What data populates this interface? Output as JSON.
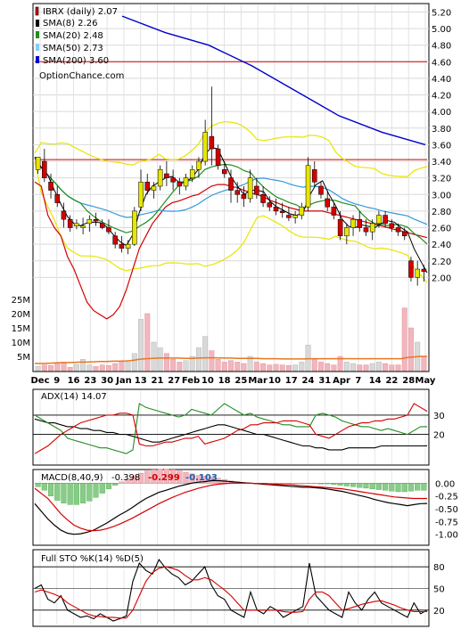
{
  "chart_data": [
    {
      "type": "candlestick",
      "title": "IBRX (daily) 2.07",
      "watermark": "OptionChance.com",
      "legend": [
        {
          "label": "SMA(8) 2.26",
          "color": "#000000"
        },
        {
          "label": "SMA(20) 2.48",
          "color": "#228b22"
        },
        {
          "label": "SMA(50) 2.73",
          "color": "#87cefa"
        },
        {
          "label": "SMA(200) 3.60",
          "color": "#0000cc"
        }
      ],
      "legend_placement": "top-left",
      "price_axis_ticks": [
        "5.20",
        "5.00",
        "4.80",
        "4.60",
        "4.40",
        "4.20",
        "4.00",
        "3.80",
        "3.60",
        "3.40",
        "3.20",
        "3.00",
        "2.80",
        "2.60",
        "2.40",
        "2.20",
        "2.00"
      ],
      "ylim": [
        1.8,
        5.28
      ],
      "volume_axis_ticks": [
        "25M",
        "20M",
        "15M",
        "10M",
        "5M"
      ],
      "volume_ylim": [
        0,
        30
      ],
      "x_labels": [
        "Dec",
        "9",
        "16",
        "23",
        "30",
        "Jan",
        "13",
        "21",
        "27",
        "Feb",
        "10",
        "18",
        "25",
        "Mar",
        "10",
        "17",
        "24",
        "31",
        "Apr",
        "7",
        "14",
        "22",
        "28",
        "May"
      ],
      "horizontal_lines": [
        4.6,
        3.42
      ],
      "sma200": [
        5.15,
        4.95,
        4.8,
        4.55,
        4.25,
        3.95,
        3.75,
        3.6
      ],
      "candles": [
        [
          3.3,
          3.45,
          3.25,
          3.45,
          3.15
        ],
        [
          3.4,
          3.55,
          3.15,
          3.2,
          3.1
        ],
        [
          3.15,
          3.25,
          2.95,
          3.05,
          2.75
        ],
        [
          3.0,
          3.1,
          2.85,
          2.9,
          2.6
        ],
        [
          2.8,
          2.9,
          2.6,
          2.7,
          2.5
        ],
        [
          2.7,
          2.75,
          2.55,
          2.6,
          2.25
        ],
        [
          2.62,
          2.7,
          2.58,
          2.65,
          2.1
        ],
        [
          2.6,
          2.72,
          2.52,
          2.62,
          1.9
        ],
        [
          2.65,
          2.75,
          2.55,
          2.7,
          1.7
        ],
        [
          2.7,
          2.78,
          2.62,
          2.68,
          1.6
        ],
        [
          2.65,
          2.7,
          2.58,
          2.6,
          1.55
        ],
        [
          2.6,
          2.7,
          2.52,
          2.55,
          1.5
        ],
        [
          2.5,
          2.55,
          2.35,
          2.4,
          1.55
        ],
        [
          2.4,
          2.5,
          2.3,
          2.35,
          1.65
        ],
        [
          2.35,
          2.45,
          2.28,
          2.4,
          1.85
        ],
        [
          2.4,
          2.85,
          2.38,
          2.8,
          2.1
        ],
        [
          2.85,
          3.3,
          2.8,
          3.15,
          2.35
        ],
        [
          3.15,
          3.25,
          3.0,
          3.05,
          2.5
        ],
        [
          3.05,
          3.15,
          2.95,
          3.1,
          2.65
        ],
        [
          3.1,
          3.35,
          3.05,
          3.3,
          2.75
        ],
        [
          3.25,
          3.4,
          3.1,
          3.2,
          2.85
        ],
        [
          3.2,
          3.3,
          3.05,
          3.15,
          2.9
        ],
        [
          3.15,
          3.2,
          3.0,
          3.1,
          2.92
        ],
        [
          3.1,
          3.25,
          3.05,
          3.2,
          2.95
        ],
        [
          3.2,
          3.35,
          3.15,
          3.3,
          2.98
        ],
        [
          3.3,
          3.45,
          3.2,
          3.4,
          3.0
        ],
        [
          3.4,
          3.9,
          3.35,
          3.75,
          3.05
        ],
        [
          3.7,
          4.3,
          3.35,
          3.55,
          3.1
        ],
        [
          3.55,
          3.6,
          3.3,
          3.35,
          3.12
        ],
        [
          3.3,
          3.4,
          3.2,
          3.25,
          3.12
        ],
        [
          3.2,
          3.3,
          2.9,
          3.05,
          3.1
        ],
        [
          3.05,
          3.15,
          2.9,
          3.0,
          3.08
        ],
        [
          3.0,
          3.1,
          2.85,
          2.95,
          3.05
        ],
        [
          2.95,
          3.3,
          2.9,
          3.2,
          3.02
        ],
        [
          3.1,
          3.2,
          2.95,
          3.0,
          3.0
        ],
        [
          3.0,
          3.1,
          2.85,
          2.9,
          2.97
        ],
        [
          2.9,
          2.98,
          2.8,
          2.85,
          2.93
        ],
        [
          2.85,
          2.95,
          2.75,
          2.8,
          2.9
        ],
        [
          2.8,
          2.9,
          2.72,
          2.78,
          2.87
        ],
        [
          2.75,
          2.85,
          2.68,
          2.72,
          2.84
        ],
        [
          2.72,
          2.8,
          2.65,
          2.75,
          2.82
        ],
        [
          2.75,
          2.9,
          2.7,
          2.85,
          2.8
        ],
        [
          2.85,
          3.45,
          2.8,
          3.35,
          2.8
        ],
        [
          3.3,
          3.4,
          3.1,
          3.15,
          2.8
        ],
        [
          3.1,
          3.15,
          2.95,
          3.0,
          2.8
        ],
        [
          2.95,
          3.05,
          2.8,
          2.85,
          2.78
        ],
        [
          2.85,
          2.9,
          2.7,
          2.75,
          2.76
        ],
        [
          2.7,
          2.8,
          2.45,
          2.5,
          2.74
        ],
        [
          2.5,
          2.65,
          2.4,
          2.6,
          2.72
        ],
        [
          2.6,
          2.75,
          2.5,
          2.7,
          2.7
        ],
        [
          2.7,
          2.8,
          2.55,
          2.6,
          2.68
        ],
        [
          2.6,
          2.7,
          2.5,
          2.55,
          2.66
        ],
        [
          2.55,
          2.7,
          2.45,
          2.65,
          2.64
        ],
        [
          2.65,
          2.8,
          2.6,
          2.75,
          2.62
        ],
        [
          2.75,
          2.8,
          2.6,
          2.65,
          2.6
        ],
        [
          2.65,
          2.7,
          2.55,
          2.6,
          2.58
        ],
        [
          2.6,
          2.65,
          2.5,
          2.55,
          2.56
        ],
        [
          2.55,
          2.6,
          2.45,
          2.5,
          2.54
        ],
        [
          2.2,
          2.25,
          1.95,
          2.0,
          2.52
        ],
        [
          2.0,
          2.2,
          1.9,
          2.1,
          2.5
        ],
        [
          2.1,
          2.15,
          1.95,
          2.07,
          2.48
        ]
      ],
      "volume": [
        1.5,
        2,
        1.8,
        2.5,
        3,
        1.2,
        2.2,
        4,
        2,
        1.5,
        2,
        1.8,
        2.5,
        3.2,
        3,
        6,
        18,
        20,
        10,
        8,
        6,
        4,
        3,
        3.5,
        5,
        8,
        12,
        7,
        4,
        3,
        3.5,
        3,
        2.5,
        5,
        3,
        2.5,
        2,
        2.2,
        2,
        1.8,
        2,
        3,
        9,
        4,
        3,
        2.5,
        2,
        5,
        3,
        2.5,
        2,
        2,
        2.5,
        3,
        2.5,
        2,
        2,
        22,
        15,
        10,
        5
      ],
      "volume_avg": [
        2.5,
        2.5,
        2.6,
        2.7,
        2.8,
        2.8,
        2.9,
        3,
        3,
        3.1,
        3.2,
        3.2,
        3.3,
        3.3,
        3.4,
        3.6,
        4,
        4.2,
        4.3,
        4.4,
        4.4,
        4.4,
        4.4,
        4.3,
        4.3,
        4.4,
        4.5,
        4.5,
        4.5,
        4.4,
        4.4,
        4.3,
        4.3,
        4.3,
        4.3,
        4.2,
        4.2,
        4.2,
        4.1,
        4.1,
        4.1,
        4.1,
        4.2,
        4.2,
        4.2,
        4.2,
        4.2,
        4.2,
        4.2,
        4.2,
        4.2,
        4.2,
        4.2,
        4.2,
        4.2,
        4.2,
        4.2,
        4.6,
        4.8,
        5,
        5
      ]
    },
    {
      "type": "line",
      "title": "ADX(14) 14.07",
      "ylim": [
        5,
        42
      ],
      "reference_lines": [
        20,
        30
      ],
      "series": [
        {
          "color": "#000000",
          "values": [
            28,
            27,
            26,
            26,
            25,
            24,
            24,
            23,
            23,
            22,
            22,
            21,
            21,
            20,
            20,
            19,
            18,
            17,
            16,
            16,
            17,
            18,
            19,
            20,
            21,
            22,
            23,
            24,
            25,
            25,
            24,
            23,
            22,
            21,
            20,
            20,
            19,
            18,
            17,
            16,
            15,
            14,
            14,
            13,
            13,
            12,
            12,
            12,
            13,
            13,
            13,
            13,
            13,
            14,
            14,
            14,
            14,
            14,
            14,
            14,
            14.07
          ]
        },
        {
          "color": "#228b22",
          "values": [
            30,
            28,
            26,
            24,
            22,
            18,
            17,
            16,
            15,
            14,
            13,
            13,
            12,
            11,
            10,
            12,
            36,
            34,
            33,
            32,
            31,
            30,
            29,
            30,
            33,
            32,
            31,
            30,
            33,
            36,
            34,
            32,
            30,
            31,
            29,
            28,
            27,
            26,
            25,
            25,
            24,
            24,
            24,
            30,
            31,
            30,
            29,
            27,
            26,
            25,
            24,
            24,
            23,
            22,
            23,
            22,
            21,
            20,
            22,
            24,
            24
          ]
        },
        {
          "color": "#d40000",
          "values": [
            10,
            12,
            14,
            17,
            20,
            22,
            24,
            26,
            27,
            28,
            29,
            30,
            30,
            31,
            31,
            30,
            15,
            14,
            14,
            15,
            16,
            16,
            17,
            18,
            18,
            19,
            15,
            16,
            17,
            18,
            20,
            22,
            23,
            25,
            25,
            26,
            26,
            26,
            27,
            27,
            27,
            26,
            25,
            20,
            19,
            18,
            20,
            22,
            24,
            25,
            26,
            26,
            27,
            27,
            28,
            28,
            29,
            30,
            36,
            34,
            32
          ]
        }
      ]
    },
    {
      "type": "line",
      "title": "MACD(8,40,9)",
      "values": [
        "-0.398",
        "-0.299",
        "-0.103"
      ],
      "ylim": [
        -1.18,
        0.18
      ],
      "y_ticks": [
        "0.00",
        "-0.25",
        "-0.50",
        "-0.75",
        "-1.00"
      ],
      "series": [
        {
          "color": "#000000",
          "values": [
            -0.4,
            -0.55,
            -0.7,
            -0.82,
            -0.92,
            -0.98,
            -1.0,
            -0.99,
            -0.96,
            -0.92,
            -0.85,
            -0.78,
            -0.7,
            -0.62,
            -0.55,
            -0.47,
            -0.38,
            -0.3,
            -0.24,
            -0.18,
            -0.14,
            -0.1,
            -0.06,
            -0.03,
            0.0,
            0.02,
            0.03,
            0.05,
            0.05,
            0.04,
            0.03,
            0.02,
            0.01,
            0.0,
            -0.01,
            -0.02,
            -0.03,
            -0.04,
            -0.05,
            -0.06,
            -0.07,
            -0.08,
            -0.08,
            -0.09,
            -0.1,
            -0.12,
            -0.14,
            -0.16,
            -0.19,
            -0.22,
            -0.25,
            -0.28,
            -0.32,
            -0.35,
            -0.38,
            -0.4,
            -0.42,
            -0.44,
            -0.42,
            -0.4,
            -0.398
          ]
        },
        {
          "color": "#d40000",
          "values": [
            -0.1,
            -0.2,
            -0.3,
            -0.45,
            -0.6,
            -0.72,
            -0.82,
            -0.88,
            -0.92,
            -0.93,
            -0.92,
            -0.89,
            -0.85,
            -0.8,
            -0.74,
            -0.68,
            -0.61,
            -0.54,
            -0.47,
            -0.4,
            -0.34,
            -0.28,
            -0.23,
            -0.18,
            -0.14,
            -0.1,
            -0.07,
            -0.04,
            -0.02,
            -0.01,
            0.0,
            0.0,
            0.0,
            0.0,
            -0.01,
            -0.01,
            -0.02,
            -0.02,
            -0.03,
            -0.03,
            -0.04,
            -0.05,
            -0.06,
            -0.07,
            -0.08,
            -0.09,
            -0.1,
            -0.11,
            -0.13,
            -0.15,
            -0.17,
            -0.19,
            -0.21,
            -0.23,
            -0.25,
            -0.27,
            -0.28,
            -0.29,
            -0.3,
            -0.3,
            -0.299
          ]
        }
      ],
      "histogram": [
        -0.05,
        -0.1,
        -0.18,
        -0.24,
        -0.28,
        -0.3,
        -0.3,
        -0.28,
        -0.25,
        -0.2,
        -0.14,
        -0.08,
        -0.03,
        0.02,
        0.06,
        0.1,
        0.14,
        0.17,
        0.19,
        0.2,
        0.2,
        0.19,
        0.17,
        0.15,
        0.13,
        0.11,
        0.1,
        0.09,
        0.07,
        0.05,
        0.03,
        0.02,
        0.01,
        0.0,
        0.0,
        0.0,
        0.0,
        0.0,
        0.0,
        0.0,
        0.0,
        0.0,
        0.0,
        0.0,
        -0.01,
        -0.01,
        -0.02,
        -0.03,
        -0.04,
        -0.05,
        -0.06,
        -0.07,
        -0.08,
        -0.09,
        -0.1,
        -0.11,
        -0.12,
        -0.12,
        -0.11,
        -0.1,
        -0.1
      ]
    },
    {
      "type": "line",
      "title": "Full STO %K(14) %D(5)",
      "ylim": [
        0,
        100
      ],
      "y_ticks": [
        "80",
        "50",
        "20"
      ],
      "reference_lines": [
        80,
        20
      ],
      "series": [
        {
          "color": "#000000",
          "values": [
            50,
            55,
            35,
            30,
            40,
            20,
            15,
            10,
            12,
            8,
            15,
            10,
            5,
            8,
            12,
            60,
            85,
            75,
            70,
            90,
            78,
            70,
            65,
            55,
            60,
            70,
            80,
            55,
            40,
            35,
            20,
            15,
            10,
            45,
            20,
            15,
            25,
            20,
            10,
            15,
            20,
            25,
            85,
            40,
            30,
            20,
            15,
            10,
            45,
            30,
            20,
            35,
            45,
            30,
            25,
            20,
            15,
            10,
            30,
            15,
            20
          ]
        },
        {
          "color": "#d40000",
          "values": [
            45,
            48,
            45,
            42,
            38,
            30,
            25,
            20,
            15,
            12,
            11,
            10,
            10,
            9,
            9,
            20,
            40,
            60,
            72,
            78,
            80,
            78,
            75,
            68,
            62,
            62,
            65,
            62,
            55,
            48,
            40,
            30,
            20,
            20,
            20,
            20,
            20,
            20,
            18,
            17,
            17,
            18,
            35,
            45,
            45,
            40,
            30,
            20,
            22,
            25,
            28,
            30,
            32,
            33,
            30,
            27,
            23,
            20,
            18,
            18,
            18
          ]
        }
      ]
    }
  ]
}
